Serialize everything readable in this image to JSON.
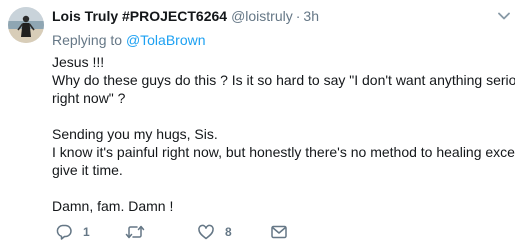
{
  "tweet": {
    "author_name": "Lois Truly #PROJECT6264",
    "author_handle": "@loistruly",
    "separator": "·",
    "timestamp": "3h",
    "replying_prefix": "Replying to ",
    "replying_to": "@TolaBrown",
    "text_lines": [
      "Jesus !!!",
      "Why do these guys do this ? Is it so hard to say \"I don't want anything serious",
      "right now\" ?",
      "",
      "Sending you my hugs, Sis.",
      "I know it's painful right now, but honestly there's no method to healing except",
      "give it time.",
      "",
      "Damn, fam. Damn !"
    ]
  },
  "actions": {
    "reply_icon": "reply-bubble-icon",
    "reply_count": "1",
    "retweet_icon": "retweet-icon",
    "retweet_count": "",
    "like_icon": "heart-icon",
    "like_count": "8",
    "dm_icon": "envelope-icon"
  },
  "icons": {
    "more": "chevron-down-icon",
    "avatar": "avatar-photo"
  },
  "colors": {
    "name": "#14171a",
    "secondary": "#657786",
    "link": "#1da1f2",
    "background": "#ffffff"
  }
}
